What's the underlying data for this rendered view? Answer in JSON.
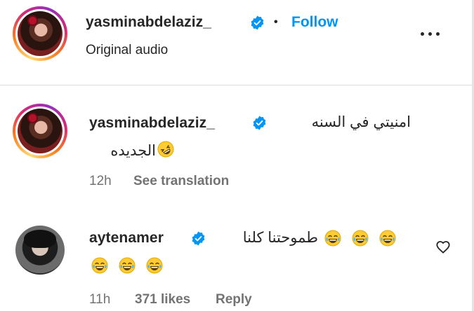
{
  "header": {
    "username": "yasminabdelaziz_",
    "separator": "•",
    "follow_label": "Follow",
    "subtitle": "Original audio"
  },
  "caption": {
    "username": "yasminabdelaziz_",
    "text_line1": "امنيتي في السنه",
    "text_line2": "الجديده",
    "time": "12h",
    "see_translation_label": "See translation"
  },
  "comment": {
    "username": "aytenamer",
    "text": "طموحتنا كلنا",
    "emoji_line1_count": 3,
    "emoji_line2_count": 3,
    "time": "11h",
    "likes": "371 likes",
    "reply_label": "Reply"
  },
  "colors": {
    "link_blue": "#0095f6",
    "verified_blue": "#0095f6",
    "muted_text": "#737373",
    "emoji_yellow": "#ffcc33"
  },
  "icons": [
    "verified-badge-icon",
    "more-options-icon",
    "heart-icon",
    "laughing-crying-emoji-icon",
    "rolling-laughing-emoji-icon"
  ]
}
